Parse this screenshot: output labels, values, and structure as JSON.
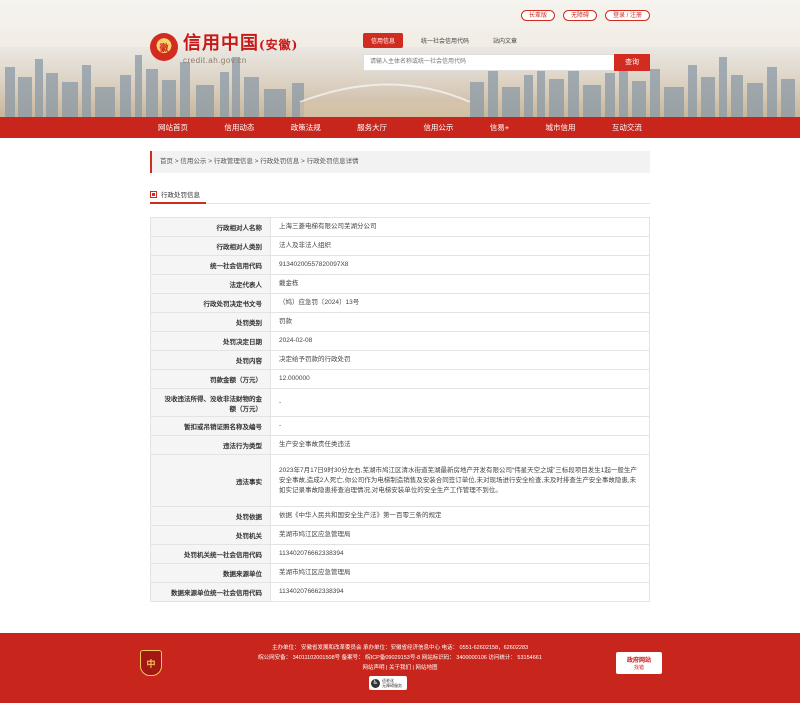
{
  "header": {
    "emblem_text": "徽",
    "logo_title": "信用中国",
    "logo_region": "(安徽)",
    "logo_sub": "credit.ah.gov.cn",
    "top_links": [
      "长辈版",
      "无障碍",
      "登录 / 注册"
    ],
    "search_tabs": [
      "信用信息",
      "统一社会信用代码",
      "站内文章"
    ],
    "search_placeholder": "请输入主体名称或统一社会信用代码",
    "search_button": "查询"
  },
  "nav": {
    "items": [
      "网站首页",
      "信用动态",
      "政策法规",
      "服务大厅",
      "信用公示",
      "信易+",
      "城市信用",
      "互动交流"
    ]
  },
  "breadcrumb": "首页 > 信用公示 > 行政管理信息 > 行政处罚信息 > 行政处罚信息详情",
  "section_title": "行政处罚信息",
  "table": {
    "rows": [
      {
        "k": "行政相对人名称",
        "v": "上海三菱电梯有限公司芜湖分公司"
      },
      {
        "k": "行政相对人类别",
        "v": "法人及非法人组织"
      },
      {
        "k": "统一社会信用代码",
        "v": "91340200557820097X8"
      },
      {
        "k": "法定代表人",
        "v": "戴金栋"
      },
      {
        "k": "行政处罚决定书文号",
        "v": "（鸠）应急罚〔2024〕13号"
      },
      {
        "k": "处罚类别",
        "v": "罚款"
      },
      {
        "k": "处罚决定日期",
        "v": "2024-02-08"
      },
      {
        "k": "处罚内容",
        "v": "决定给予罚款的行政处罚"
      },
      {
        "k": "罚款金额（万元）",
        "v": "12.000000"
      },
      {
        "k": "没收违法所得、没收非法财物的金额（万元）",
        "v": "-"
      },
      {
        "k": "暂扣或吊销证照名称及编号",
        "v": "-"
      },
      {
        "k": "违法行为类型",
        "v": "生产安全事故责任类违法"
      },
      {
        "k": "违法事实",
        "v": "2023年7月17日9时30分左右,芜湖市鸠江区清水街道芜湖最新房地产开发有限公司“伟星天空之城”三标段项目发生1起一般生产安全事故,造成2人死亡,你公司作为电梯制造销售及安装合同签订单位,未对现场进行安全检查,未及时排查生产安全事故隐患,未如实记录事故隐患排查治理情况,对电梯安装单位的安全生产工作管理不到位。"
      },
      {
        "k": "处罚依据",
        "v": "依据《中华人民共和国安全生产法》第一百零三条的规定"
      },
      {
        "k": "处罚机关",
        "v": "芜湖市鸠江区应急管理局"
      },
      {
        "k": "处罚机关统一社会信用代码",
        "v": "11340207666233839​4"
      },
      {
        "k": "数据来源单位",
        "v": "芜湖市鸠江区应急管理局"
      },
      {
        "k": "数据来源单位统一社会信用代码",
        "v": "11340207666233839​4"
      }
    ]
  },
  "footer": {
    "line1": "主办单位：  安徽省发展和改革委员会    承办单位：安徽省经济信息中心    电话：  0551-62602158，62602283",
    "line2": "皖公网安备：  34011102001508号    备案号：  皖ICP备09029153号-8    网站标识码：  3400000106    访问统计：  53154661",
    "line3": "网站声明 | 关于我们 | 网站地图",
    "badge_text": "中",
    "gov_line1": "政府网站",
    "gov_line2": "找错",
    "access_line1": "适老化",
    "access_line2": "无障碍服务"
  }
}
